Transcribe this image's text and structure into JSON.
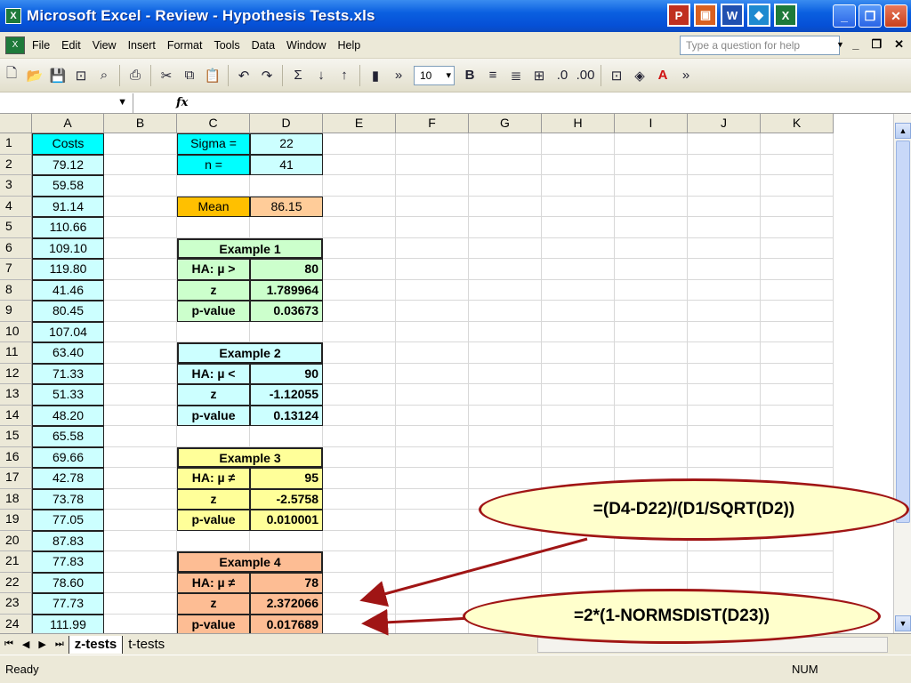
{
  "window": {
    "title": "Microsoft Excel - Review - Hypothesis Tests.xls"
  },
  "menu": [
    "File",
    "Edit",
    "View",
    "Insert",
    "Format",
    "Tools",
    "Data",
    "Window",
    "Help"
  ],
  "help_placeholder": "Type a question for help",
  "toolbar": {
    "font_size": "10"
  },
  "formula_bar": {
    "fx": "fx",
    "name_box": ""
  },
  "columns": [
    "A",
    "B",
    "C",
    "D",
    "E",
    "F",
    "G",
    "H",
    "I",
    "J",
    "K"
  ],
  "rows": [
    "1",
    "2",
    "3",
    "4",
    "5",
    "6",
    "7",
    "8",
    "9",
    "10",
    "11",
    "12",
    "13",
    "14",
    "15",
    "16",
    "17",
    "18",
    "19",
    "20",
    "21",
    "22",
    "23",
    "24"
  ],
  "costs": [
    "Costs",
    "79.12",
    "59.58",
    "91.14",
    "110.66",
    "109.10",
    "119.80",
    "41.46",
    "80.45",
    "107.04",
    "63.40",
    "71.33",
    "51.33",
    "48.20",
    "65.58",
    "69.66",
    "42.78",
    "73.78",
    "77.05",
    "87.83",
    "77.83",
    "78.60",
    "77.73",
    "111.99"
  ],
  "params": {
    "sigma_label": "Sigma =",
    "sigma": "22",
    "n_label": "n =",
    "n": "41",
    "mean_label": "Mean",
    "mean": "86.15"
  },
  "examples": [
    {
      "title": "Example 1",
      "ha": "HA:  µ >",
      "ha_val": "80",
      "z": "1.789964",
      "p": "0.03673",
      "color": "#ccffcc"
    },
    {
      "title": "Example 2",
      "ha": "HA:  µ <",
      "ha_val": "90",
      "z": "-1.12055",
      "p": "0.13124",
      "color": "#ccffff"
    },
    {
      "title": "Example 3",
      "ha": "HA:  µ ≠",
      "ha_val": "95",
      "z": "-2.5758",
      "p": "0.010001",
      "color": "#ffff99"
    },
    {
      "title": "Example 4",
      "ha": "HA:  µ ≠",
      "ha_val": "78",
      "z": "2.372066",
      "p": "0.017689",
      "color": "#fdbd94"
    }
  ],
  "labels": {
    "z": "z",
    "p": "p-value"
  },
  "callouts": {
    "z_formula": "=(D4-D22)/(D1/SQRT(D2))",
    "p_formula": "=2*(1-NORMSDIST(D23))"
  },
  "sheets": [
    "z-tests",
    "t-tests"
  ],
  "status": {
    "ready": "Ready",
    "num": "NUM"
  }
}
